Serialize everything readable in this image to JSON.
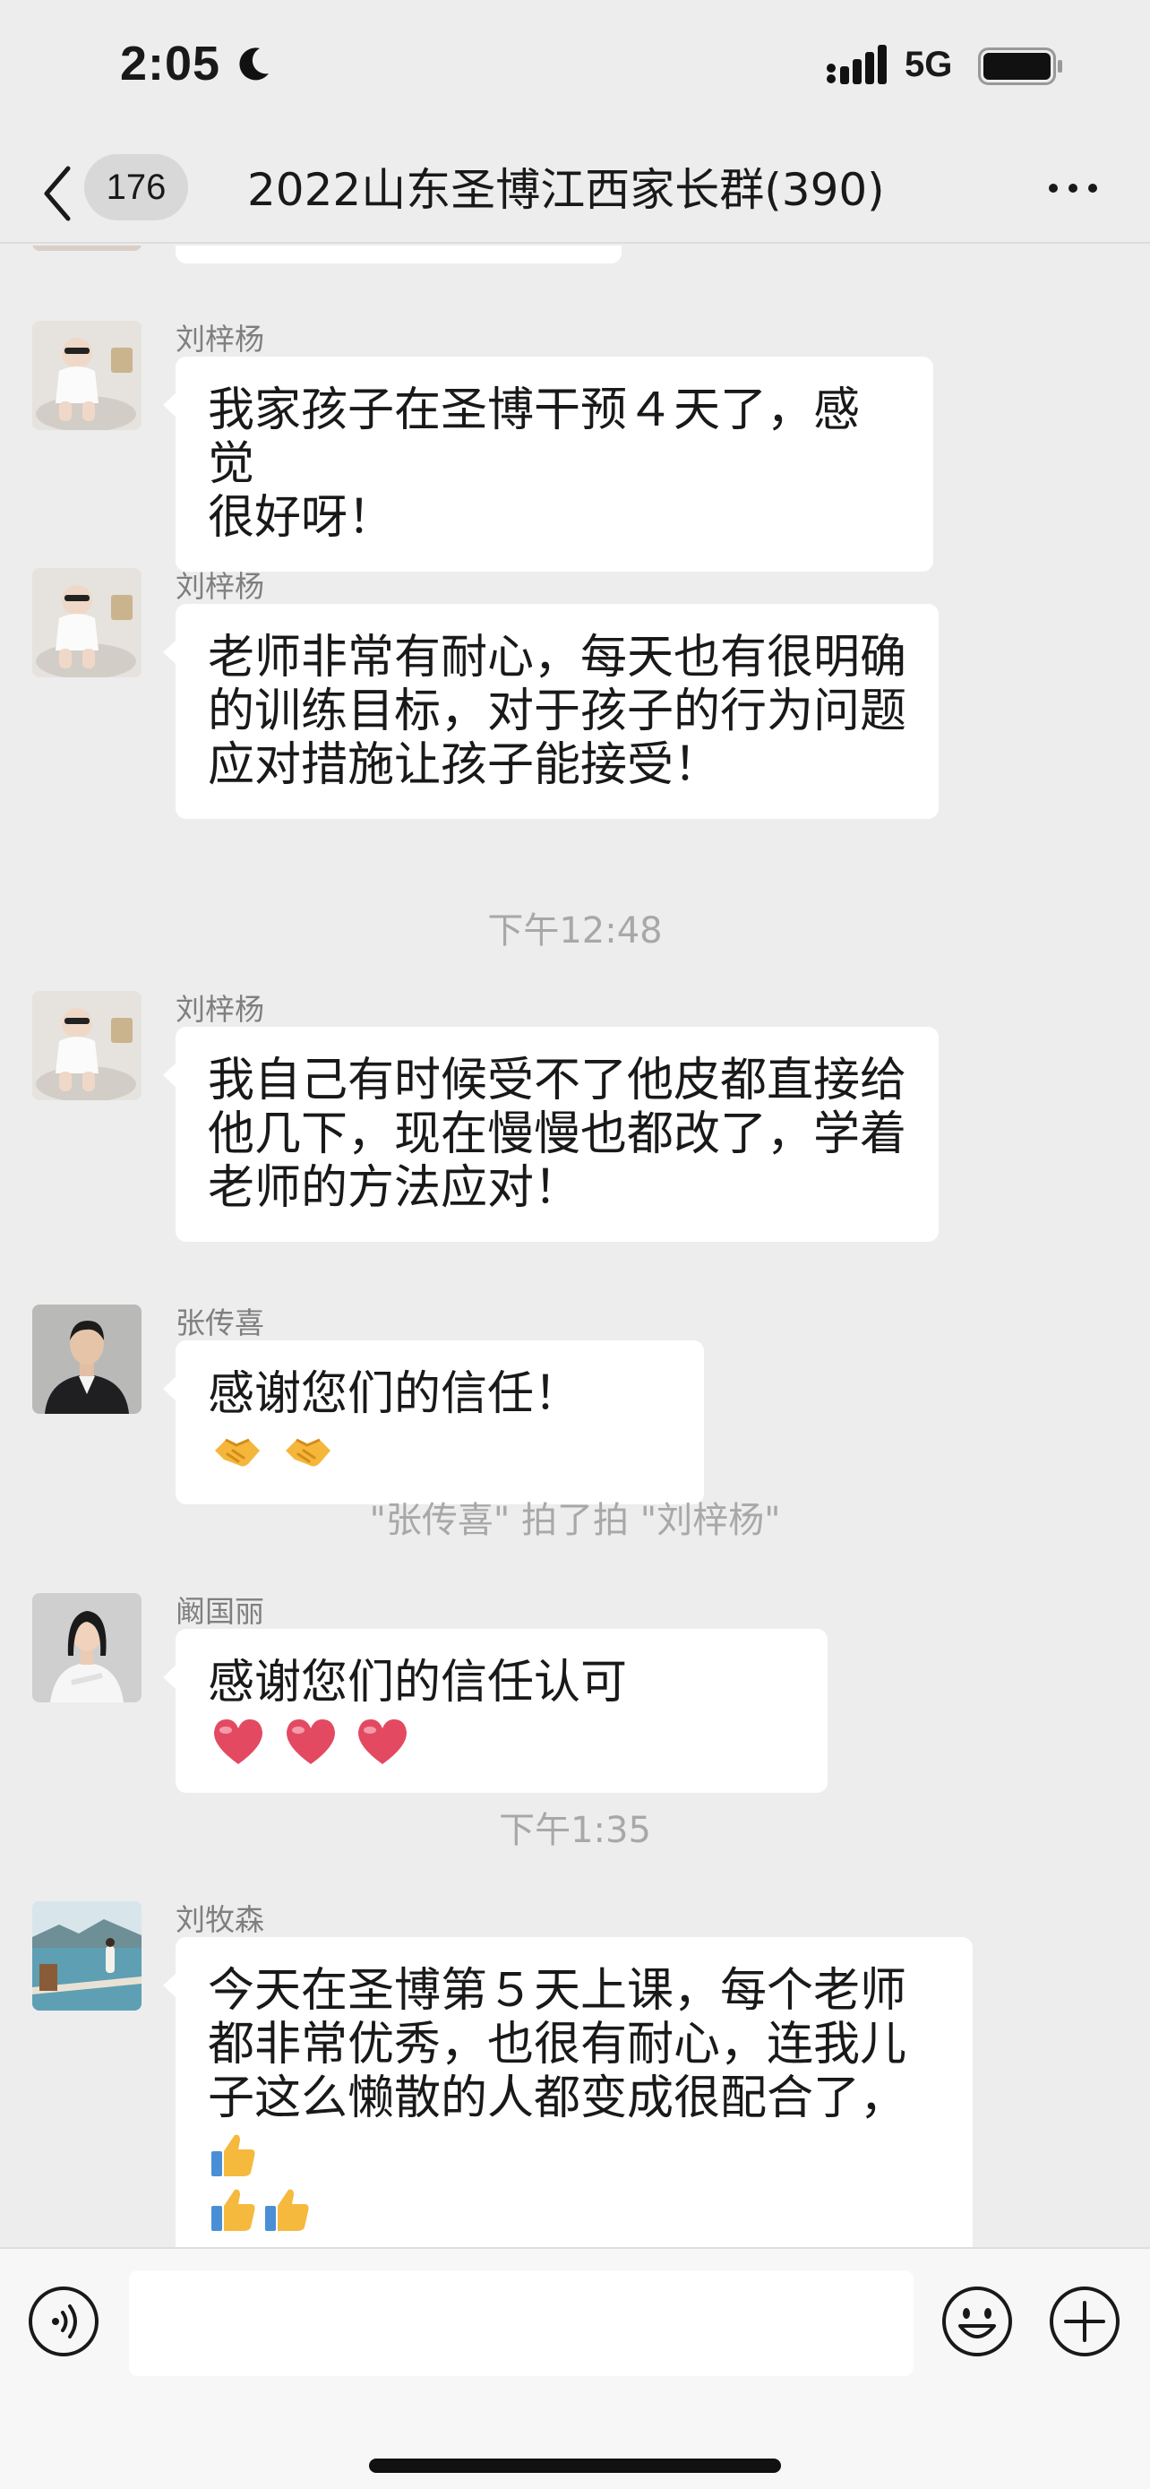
{
  "status_bar": {
    "time": "2:05",
    "network": "5G"
  },
  "nav": {
    "unread_count": "176",
    "title": "2022山东圣博江西家长群(390)"
  },
  "messages": [
    {
      "sender": "刘梓杨",
      "lines": [
        "我家孩子在圣博干预４天了，感觉",
        "很好呀！"
      ]
    },
    {
      "sender": "刘梓杨",
      "lines": [
        "老师非常有耐心，每天也有很明确",
        "的训练目标，对于孩子的行为问题",
        "应对措施让孩子能接受！"
      ]
    },
    {
      "sender": "刘梓杨",
      "lines": [
        "我自己有时候受不了他皮都直接给",
        "他几下，现在慢慢也都改了，学着",
        "老师的方法应对！"
      ]
    },
    {
      "sender": "张传喜",
      "text": "感谢您们的信任！"
    },
    {
      "sender": "阚国丽",
      "text": "感谢您们的信任认可"
    },
    {
      "sender": "刘牧森",
      "lines": [
        "今天在圣博第５天上课，每个老师",
        "都非常优秀，也很有耐心，连我儿",
        "子这么懒散的人都变成很配合了，"
      ]
    }
  ],
  "time_dividers": [
    "下午12:48",
    "下午1:35"
  ],
  "system_notice": "\"张传喜\" 拍了拍 \"刘梓杨\"",
  "icons": {
    "emoji_handshake": "handshake-emoji",
    "emoji_heart": "red-heart-emoji",
    "emoji_thumbs_up": "thumbs-up-emoji"
  },
  "colors": {
    "background": "#ededed",
    "bubble": "#ffffff",
    "meta_text": "#a8a8a8"
  }
}
